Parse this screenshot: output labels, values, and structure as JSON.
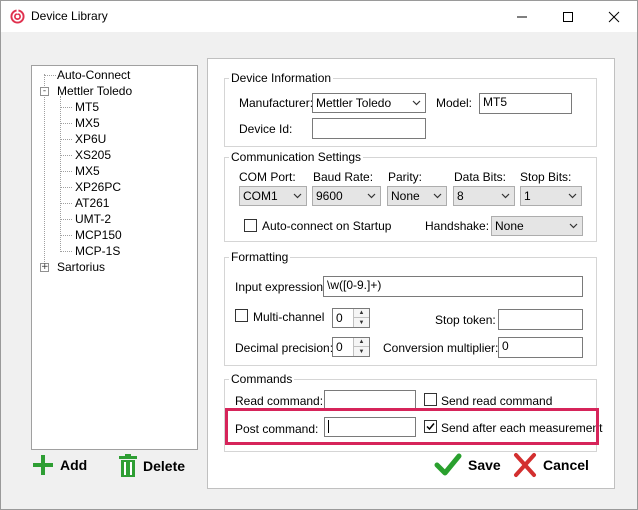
{
  "window": {
    "title": "Device Library"
  },
  "tree": {
    "nodes": [
      {
        "label": "Auto-Connect"
      },
      {
        "label": "Mettler Toledo",
        "expander": "-"
      },
      {
        "label": "MT5"
      },
      {
        "label": "MX5"
      },
      {
        "label": "XP6U"
      },
      {
        "label": "XS205"
      },
      {
        "label": "MX5"
      },
      {
        "label": "XP26PC"
      },
      {
        "label": "AT261"
      },
      {
        "label": "UMT-2"
      },
      {
        "label": "MCP150"
      },
      {
        "label": "MCP-1S"
      },
      {
        "label": "Sartorius",
        "expander": "+"
      }
    ]
  },
  "buttons": {
    "add": "Add",
    "delete": "Delete",
    "save": "Save",
    "cancel": "Cancel"
  },
  "device_info": {
    "legend": "Device Information",
    "manufacturer_label": "Manufacturer:",
    "manufacturer_value": "Mettler Toledo",
    "model_label": "Model:",
    "model_value": "MT5",
    "device_id_label": "Device Id:",
    "device_id_value": ""
  },
  "comm": {
    "legend": "Communication Settings",
    "com_port_label": "COM Port:",
    "com_port_value": "COM1",
    "baud_rate_label": "Baud Rate:",
    "baud_rate_value": "9600",
    "parity_label": "Parity:",
    "parity_value": "None",
    "data_bits_label": "Data Bits:",
    "data_bits_value": "8",
    "stop_bits_label": "Stop Bits:",
    "stop_bits_value": "1",
    "auto_connect_label": "Auto-connect on Startup",
    "auto_connect_checked": false,
    "handshake_label": "Handshake:",
    "handshake_value": "None"
  },
  "formatting": {
    "legend": "Formatting",
    "input_expression_label": "Input expression:",
    "input_expression_value": "\\w([0-9.]+)",
    "multichannel_label": "Multi-channel",
    "multichannel_checked": false,
    "multichannel_value": "0",
    "stop_token_label": "Stop token:",
    "stop_token_value": "",
    "decimal_precision_label": "Decimal precision:",
    "decimal_precision_value": "0",
    "conversion_multiplier_label": "Conversion multiplier:",
    "conversion_multiplier_value": "0"
  },
  "commands": {
    "legend": "Commands",
    "read_command_label": "Read command:",
    "read_command_value": "",
    "send_read_label": "Send read command",
    "send_read_checked": false,
    "post_command_label": "Post command:",
    "post_command_value": "",
    "send_after_label": "Send after each measurement",
    "send_after_checked": true
  },
  "colors": {
    "highlight": "#d6245a",
    "add_green": "#2e9e33",
    "delete_green": "#2e9e33",
    "save_green": "#2aa02e",
    "cancel_red": "#d32f2f"
  }
}
